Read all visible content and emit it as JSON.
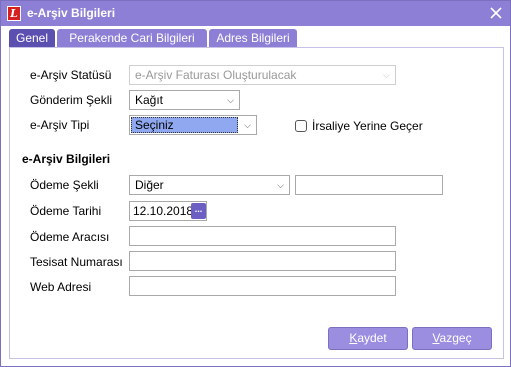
{
  "window": {
    "title": "e-Arşiv Bilgileri"
  },
  "tabs": [
    {
      "label": "Genel",
      "active": true
    },
    {
      "label": "Perakende Cari Bilgileri",
      "active": false
    },
    {
      "label": "Adres Bilgileri",
      "active": false
    }
  ],
  "form": {
    "status": {
      "label": "e-Arşiv Statüsü",
      "value": "e-Arşiv Faturası Oluşturulacak"
    },
    "send_type": {
      "label": "Gönderim Şekli",
      "value": "Kağıt"
    },
    "archive_type": {
      "label": "e-Arşiv Tipi",
      "value": "Seçiniz"
    },
    "waybill_checkbox": {
      "label": "İrsaliye Yerine Geçer",
      "checked": false
    }
  },
  "section_title": "e-Arşiv Bilgileri",
  "archive_info": {
    "payment_method": {
      "label": "Ödeme Şekli",
      "value": "Diğer",
      "extra": ""
    },
    "payment_date": {
      "label": "Ödeme Tarihi",
      "value": "12.10.2018",
      "picker_label": "..."
    },
    "payment_agent": {
      "label": "Ödeme Aracısı",
      "value": ""
    },
    "facility_no": {
      "label": "Tesisat Numarası",
      "value": ""
    },
    "web_address": {
      "label": "Web Adresi",
      "value": ""
    }
  },
  "buttons": {
    "save": {
      "first": "K",
      "rest": "aydet"
    },
    "cancel": {
      "first": "V",
      "rest": "azgeç"
    }
  },
  "icons": {
    "app": "logo-icon",
    "close": "close-icon",
    "dropdown": "chevron-down-icon",
    "calendar": "date-picker-icon"
  },
  "colors": {
    "titlebar": "#8e7fd6",
    "tab_active": "#5b4fb0",
    "button": "#9b8de0",
    "selection": "#8fa8ef"
  }
}
